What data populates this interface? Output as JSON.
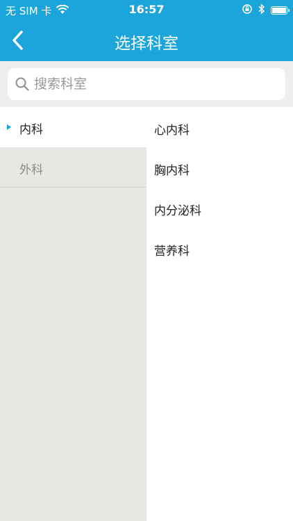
{
  "status_bar": {
    "carrier": "无 SIM 卡",
    "time": "16:57"
  },
  "nav": {
    "title": "选择科室",
    "back_icon": "chevron-left-icon"
  },
  "search": {
    "placeholder": "搜索科室",
    "value": ""
  },
  "categories": [
    {
      "label": "内科",
      "selected": true
    },
    {
      "label": "外科",
      "selected": false
    }
  ],
  "departments": [
    {
      "label": "心内科"
    },
    {
      "label": "胸内科"
    },
    {
      "label": "内分泌科"
    },
    {
      "label": "营养科"
    }
  ],
  "colors": {
    "accent": "#1ba5da",
    "sidebar_bg": "#e8e7e3",
    "search_bg": "#eeeeee"
  }
}
